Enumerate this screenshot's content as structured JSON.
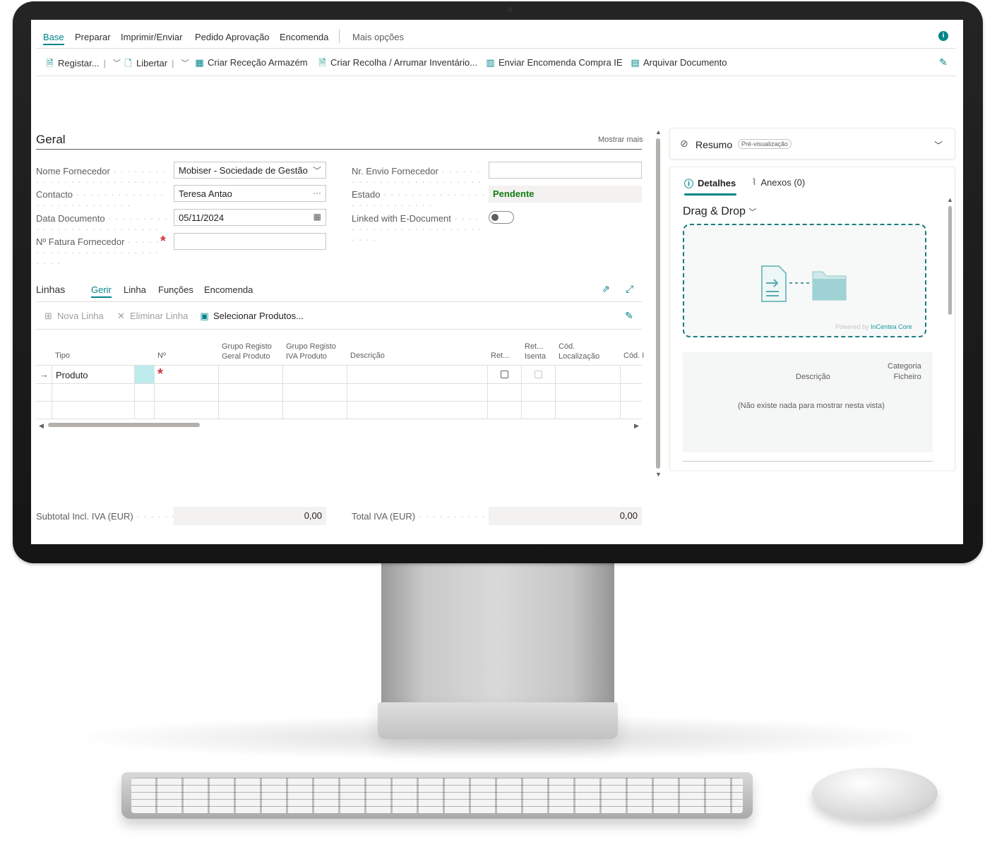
{
  "nav": {
    "tabs": [
      "Base",
      "Preparar",
      "Imprimir/Enviar",
      "Pedido Aprovação",
      "Encomenda"
    ],
    "more": "Mais opções"
  },
  "actions": {
    "register": "Registar...",
    "release": "Libertar",
    "create_receipt": "Criar Receção Armazém",
    "create_pick": "Criar Recolha / Arrumar Inventário...",
    "send_ic": "Enviar Encomenda Compra IE",
    "archive": "Arquivar Documento"
  },
  "general": {
    "title": "Geral",
    "show_more": "Mostrar mais",
    "vendor_name_label": "Nome Fornecedor",
    "vendor_name_value": "Mobiser - Sociedade de Gestão e",
    "contact_label": "Contacto",
    "contact_value": "Teresa Antao",
    "doc_date_label": "Data Documento",
    "doc_date_value": "05/11/2024",
    "vendor_invoice_label": "Nº Fatura Fornecedor",
    "vendor_invoice_value": "",
    "vendor_shipment_label": "Nr. Envio Fornecedor",
    "vendor_shipment_value": "",
    "status_label": "Estado",
    "status_value": "Pendente",
    "linked_label": "Linked with E-Document"
  },
  "lines": {
    "title": "Linhas",
    "tabs": [
      "Gerir",
      "Linha",
      "Funções",
      "Encomenda"
    ],
    "new_line": "Nova Linha",
    "delete_line": "Eliminar Linha",
    "select_items": "Selecionar Produtos...",
    "columns": {
      "type": "Tipo",
      "no": "Nº",
      "gen_prod_1": "Grupo Registo",
      "gen_prod_2": "Geral Produto",
      "vat_prod_1": "Grupo Registo",
      "vat_prod_2": "IVA Produto",
      "description": "Descrição",
      "ret": "Ret...",
      "ret_exempt_1": "Ret...",
      "ret_exempt_2": "Isenta",
      "loc_1": "Cód.",
      "loc_2": "Localização",
      "cod": "Cód. I"
    },
    "rows": [
      {
        "type": "Produto"
      }
    ]
  },
  "totals": {
    "subtotal_label": "Subtotal Incl. IVA (EUR)",
    "subtotal_value": "0,00",
    "vat_label": "Total IVA (EUR)",
    "vat_value": "0,00"
  },
  "factbox": {
    "summary_title": "Resumo",
    "preview_badge": "Pré-visualização",
    "details_tab": "Detalhes",
    "attachments_tab": "Anexos (0)",
    "dd_title": "Drag & Drop",
    "powered_prefix": "Powered by",
    "powered_brand": "InCentea Core",
    "col_description": "Descrição",
    "col_category_1": "Categoria",
    "col_category_2": "Ficheiro",
    "empty": "(Não existe nada para mostrar nesta vista)"
  },
  "colors": {
    "accent": "#008489",
    "status_green": "#107c10",
    "required": "#d13438",
    "dropzone_border": "#1b7d81"
  }
}
